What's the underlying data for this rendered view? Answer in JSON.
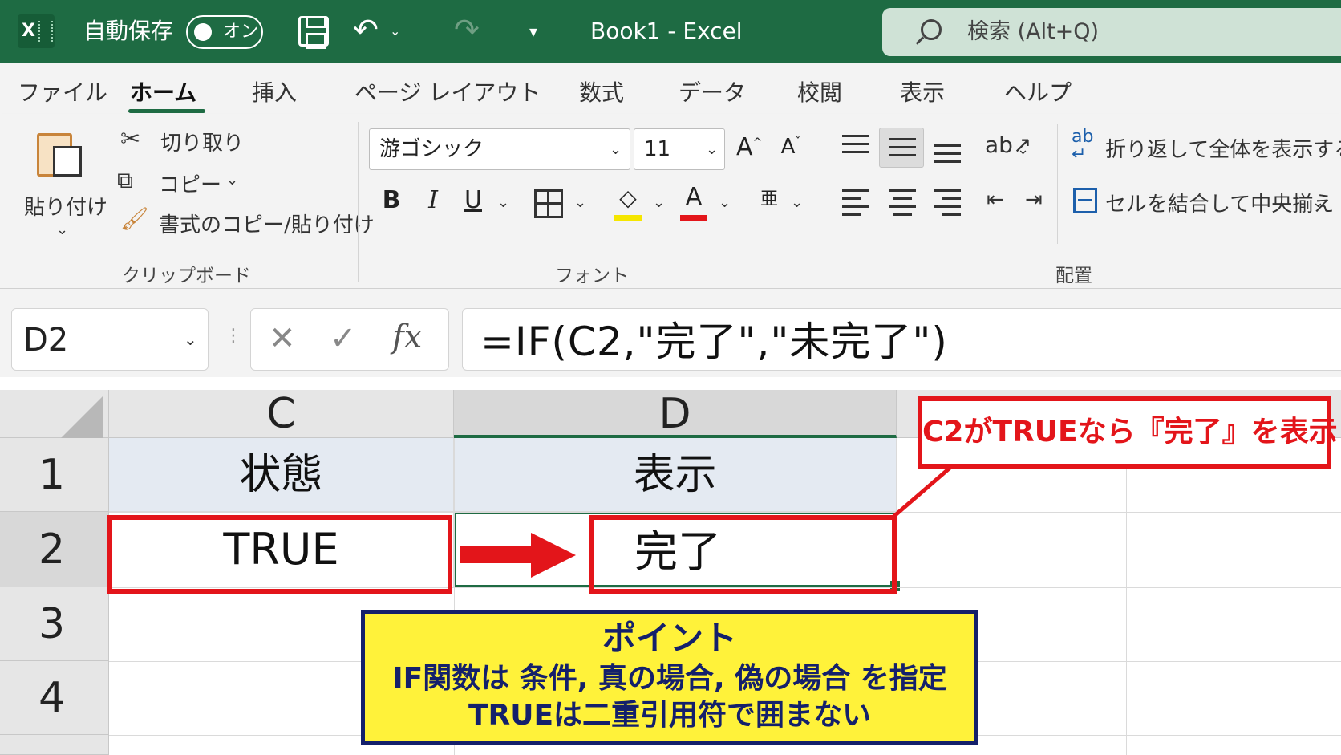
{
  "window": {
    "app_logo": "X",
    "autosave_label": "自動保存",
    "autosave_toggle": "オン",
    "title": "Book1  -  Excel",
    "search_placeholder": "検索 (Alt+Q)"
  },
  "tabs": [
    "ファイル",
    "ホーム",
    "挿入",
    "ページ レイアウト",
    "数式",
    "データ",
    "校閲",
    "表示",
    "ヘルプ"
  ],
  "active_tab": "ホーム",
  "ribbon": {
    "clipboard": {
      "paste_label": "貼り付け",
      "cut_label": "切り取り",
      "copy_label": "コピー",
      "format_painter_label": "書式のコピー/貼り付け",
      "group_label": "クリップボード"
    },
    "font": {
      "font_name": "游ゴシック",
      "font_size": "11",
      "grow_label": "A",
      "shrink_label": "A",
      "bold": "B",
      "italic": "I",
      "underline": "U",
      "font_color_glyph": "A",
      "group_label": "フォント"
    },
    "alignment": {
      "wrap_text_label": "折り返して全体を表示する",
      "merge_center_label": "セルを結合して中央揃え",
      "group_label": "配置"
    }
  },
  "formula_bar": {
    "name_box": "D2",
    "cancel_glyph": "✕",
    "enter_glyph": "✓",
    "fx_glyph": "fx",
    "formula": "=IF(C2,\"完了\",\"未完了\")"
  },
  "sheet": {
    "columns": [
      "C",
      "D"
    ],
    "rows": [
      "1",
      "2",
      "3",
      "4"
    ],
    "cells": {
      "C1": "状態",
      "D1": "表示",
      "C2": "TRUE",
      "D2": "完了"
    },
    "selected_cell": "D2"
  },
  "annotations": {
    "callout": "C2がTRUEなら『完了』を表示",
    "note_title": "ポイント",
    "note_line1": "IF関数は 条件, 真の場合, 偽の場合 を指定",
    "note_line2": "TRUEは二重引用符で囲まない",
    "highlight_color": "#e3151a",
    "note_background": "#fff23a",
    "note_text_color": "#14206b"
  },
  "colors": {
    "excel_green": "#1e6b43",
    "ribbon_bg": "#f3f3f3"
  }
}
